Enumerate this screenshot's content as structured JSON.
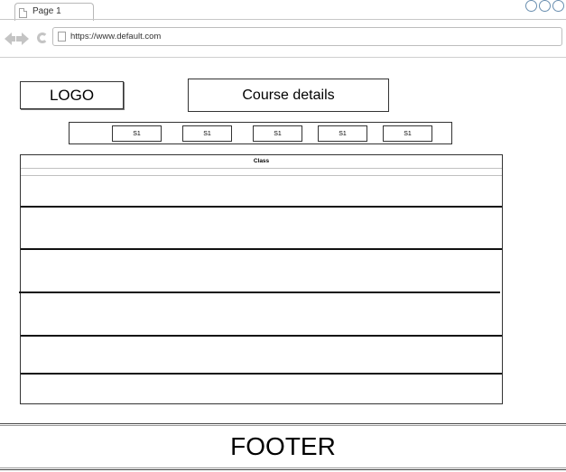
{
  "browser": {
    "tab_label": "Page 1",
    "url": "https://www.default.com"
  },
  "header": {
    "logo_text": "LOGO",
    "title": "Course details"
  },
  "subnav": {
    "tabs": [
      "S1",
      "S1",
      "S1",
      "S1",
      "S1"
    ]
  },
  "class_table": {
    "title": "Class"
  },
  "footer": {
    "text": "FOOTER"
  },
  "icons": {
    "tab": "page-icon",
    "back": "back-arrow-icon",
    "forward": "forward-arrow-icon",
    "refresh": "refresh-icon",
    "url": "page-icon",
    "window_controls": "circle-icon"
  },
  "colors": {
    "window_control": "#6a8fb0",
    "nav_icon": "#c4c4c4",
    "border": "#333333"
  }
}
